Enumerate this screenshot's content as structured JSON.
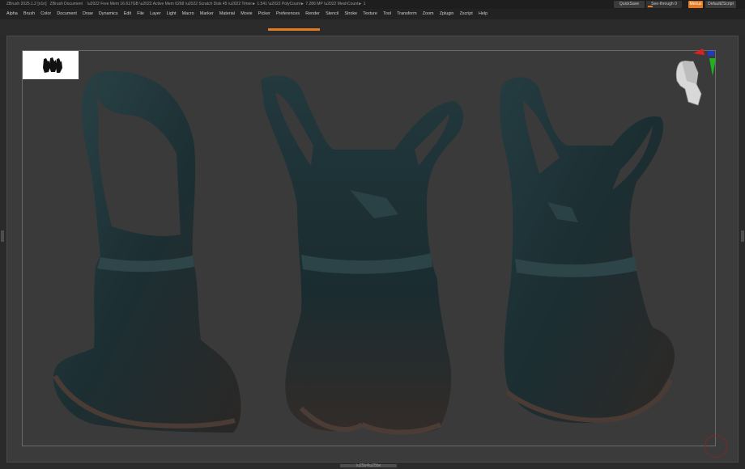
{
  "titlebar": {
    "app": "ZBrush 2025.1.2 [n1n]",
    "document": "ZBrush Document",
    "free_mem": "Free Mem 16.617GB",
    "active_mem": "Active Mem 6268",
    "scratch_disk": "Scratch Disk 45",
    "timer": "Timer► 1.541",
    "polycount": "PolyCount► 7.286 MP",
    "meshcount": "MeshCount► 1",
    "quicksave": "QuickSave",
    "see_through": "See-through",
    "see_through_value": "0",
    "menus": "Menus",
    "default_zscript": "DefaultZScript"
  },
  "menus": [
    "Alpha",
    "Brush",
    "Color",
    "Document",
    "Draw",
    "Dynamics",
    "Edit",
    "File",
    "Layer",
    "Light",
    "Macro",
    "Marker",
    "Material",
    "Movie",
    "Picker",
    "Preferences",
    "Render",
    "Stencil",
    "Stroke",
    "Texture",
    "Tool",
    "Transform",
    "Zoom",
    "Zplugin",
    "Zscript",
    "Help"
  ],
  "colors": {
    "accent": "#e37b22",
    "cloth": "#1d3236",
    "background": "#3a3a3a"
  },
  "icons": {
    "nav": "head-navigation-icon",
    "record": "record-circle-icon",
    "thumbnail": "tool-thumbnail-icon"
  }
}
